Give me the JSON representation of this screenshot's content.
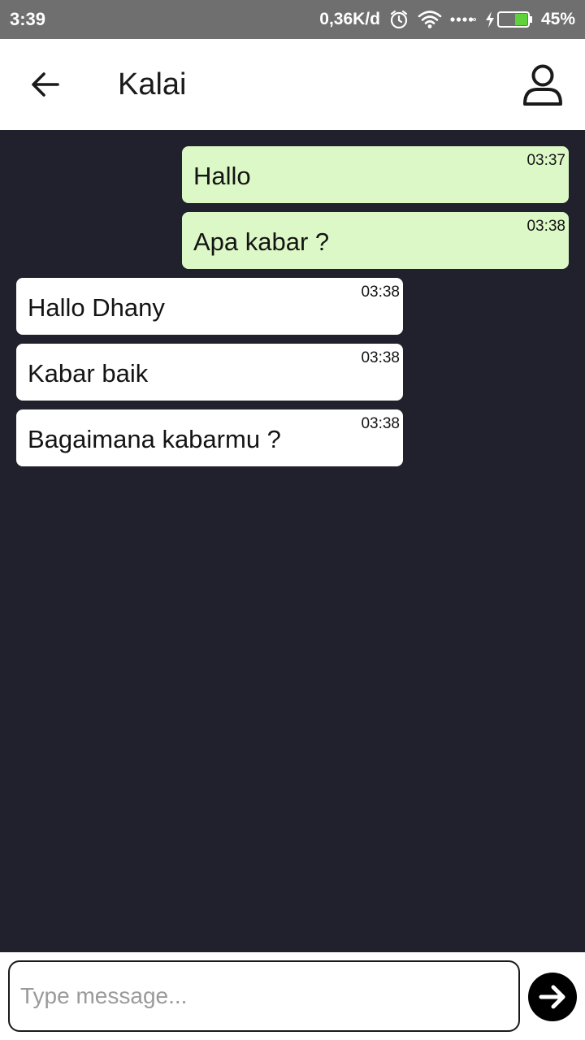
{
  "status_bar": {
    "time": "3:39",
    "network_speed": "0,36K/d",
    "battery_percent": "45%",
    "battery_level": 0.45,
    "icons": [
      "alarm-icon",
      "wifi-icon",
      "signal-dots-icon",
      "charging-icon",
      "battery-icon"
    ]
  },
  "header": {
    "title": "Kalai",
    "back_icon": "arrow-left-icon",
    "profile_icon": "user-icon"
  },
  "messages": [
    {
      "text": "Hallo",
      "time": "03:37",
      "direction": "sent"
    },
    {
      "text": "Apa kabar ?",
      "time": "03:38",
      "direction": "sent"
    },
    {
      "text": "Hallo Dhany",
      "time": "03:38",
      "direction": "received"
    },
    {
      "text": "Kabar baik",
      "time": "03:38",
      "direction": "received"
    },
    {
      "text": "Bagaimana kabarmu ?",
      "time": "03:38",
      "direction": "received"
    }
  ],
  "composer": {
    "placeholder": "Type message...",
    "value": "",
    "send_icon": "arrow-right-circle-icon"
  },
  "colors": {
    "chat_background": "#21202d",
    "sent_bubble": "#dcf8c6",
    "received_bubble": "#ffffff",
    "status_bar": "#6f6f6f",
    "battery_fill": "#5fd13b"
  }
}
